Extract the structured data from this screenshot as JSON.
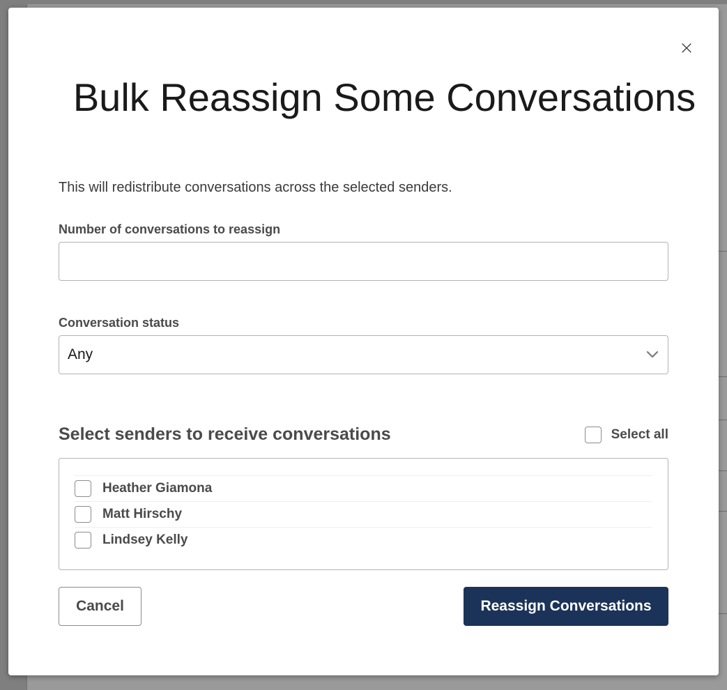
{
  "modal": {
    "title": "Bulk Reassign Some Conversations",
    "close_symbol": "×",
    "description": "This will redistribute conversations across the selected senders."
  },
  "count_field": {
    "label": "Number of conversations to reassign",
    "value": "",
    "placeholder": ""
  },
  "status_field": {
    "label": "Conversation status",
    "selected": "Any"
  },
  "senders": {
    "title": "Select senders to receive conversations",
    "select_all_label": "Select all",
    "items": [
      {
        "label": "Heather Giamona",
        "checked": false
      },
      {
        "label": "Matt Hirschy",
        "checked": false
      },
      {
        "label": "Lindsey Kelly",
        "checked": false
      }
    ]
  },
  "actions": {
    "cancel_label": "Cancel",
    "submit_label": "Reassign Conversations"
  },
  "colors": {
    "primary": "#1b3358",
    "text": "#4a4a4a",
    "border": "#b3b3b3"
  },
  "icons": {
    "close": "close-icon",
    "dropdown": "chevron-down-icon",
    "checkbox": "checkbox-icon"
  }
}
